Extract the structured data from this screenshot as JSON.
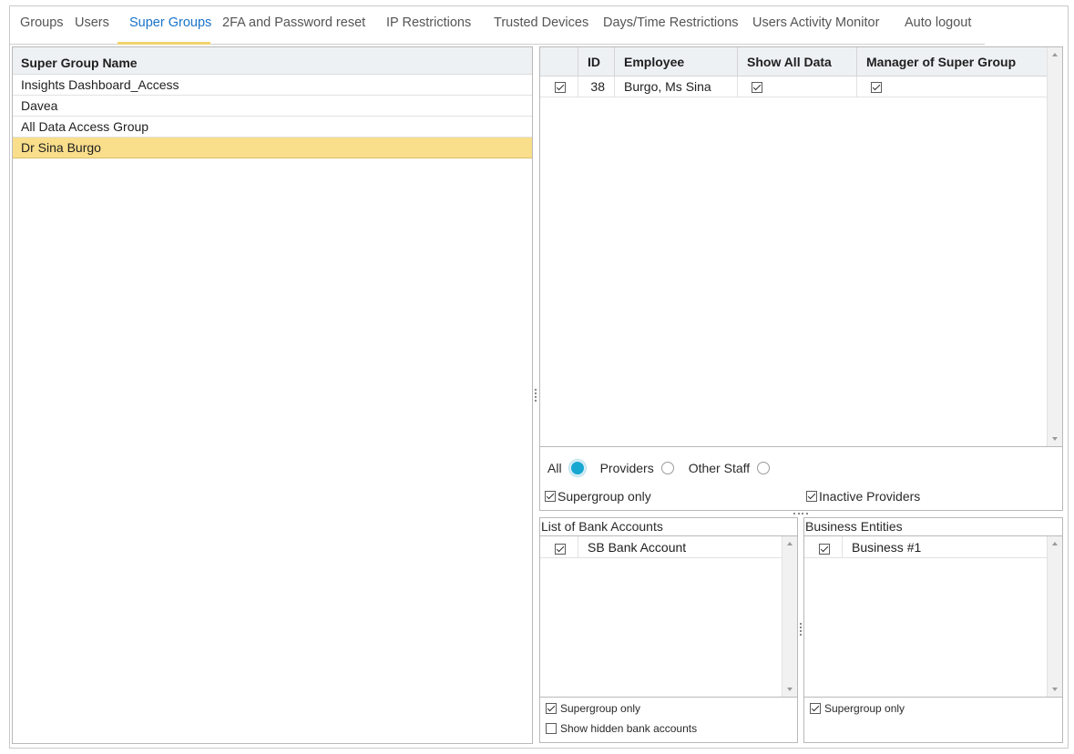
{
  "tabs": [
    {
      "label": "Groups",
      "active": false
    },
    {
      "label": "Users",
      "active": false
    },
    {
      "label": "Super Groups",
      "active": true
    },
    {
      "label": "2FA and Password reset",
      "active": false
    },
    {
      "label": "IP Restrictions",
      "active": false
    },
    {
      "label": "Trusted Devices",
      "active": false
    },
    {
      "label": "Days/Time Restrictions",
      "active": false
    },
    {
      "label": "Users Activity Monitor",
      "active": false
    },
    {
      "label": "Auto logout",
      "active": false
    }
  ],
  "colors": {
    "active_tab": "#1a73c9",
    "tab_underline": "#f3d36d",
    "selected_row": "#f9de8b",
    "radio_on": "#18a7d1",
    "header_bg": "#eef1f4"
  },
  "super_groups": {
    "header": "Super Group Name",
    "rows": [
      "Insights Dashboard_Access",
      "Davea",
      "All Data Access Group",
      "Dr Sina Burgo"
    ],
    "selected_index": 3
  },
  "members_grid": {
    "columns": [
      "",
      "ID",
      "Employee",
      "Show All Data",
      "Manager of Super Group"
    ],
    "rows": [
      {
        "selected": true,
        "id": "38",
        "employee": "Burgo, Ms Sina",
        "show_all_data": true,
        "manager": true
      }
    ]
  },
  "filter": {
    "radio_options": [
      {
        "label": "All",
        "selected": true
      },
      {
        "label": "Providers",
        "selected": false
      },
      {
        "label": "Other Staff",
        "selected": false
      }
    ],
    "supergroup_only": {
      "label": "Supergroup only",
      "checked": true
    },
    "inactive_providers": {
      "label": "Inactive Providers",
      "checked": true
    }
  },
  "bank_accounts": {
    "title": "List of Bank Accounts",
    "rows": [
      {
        "checked": true,
        "name": "SB Bank Account"
      }
    ],
    "supergroup_only": {
      "label": "Supergroup only",
      "checked": true
    },
    "show_hidden": {
      "label": "Show hidden bank accounts",
      "checked": false
    }
  },
  "business_entities": {
    "title": "Business Entities",
    "rows": [
      {
        "checked": true,
        "name": "Business #1"
      }
    ],
    "supergroup_only": {
      "label": "Supergroup only",
      "checked": true
    }
  }
}
